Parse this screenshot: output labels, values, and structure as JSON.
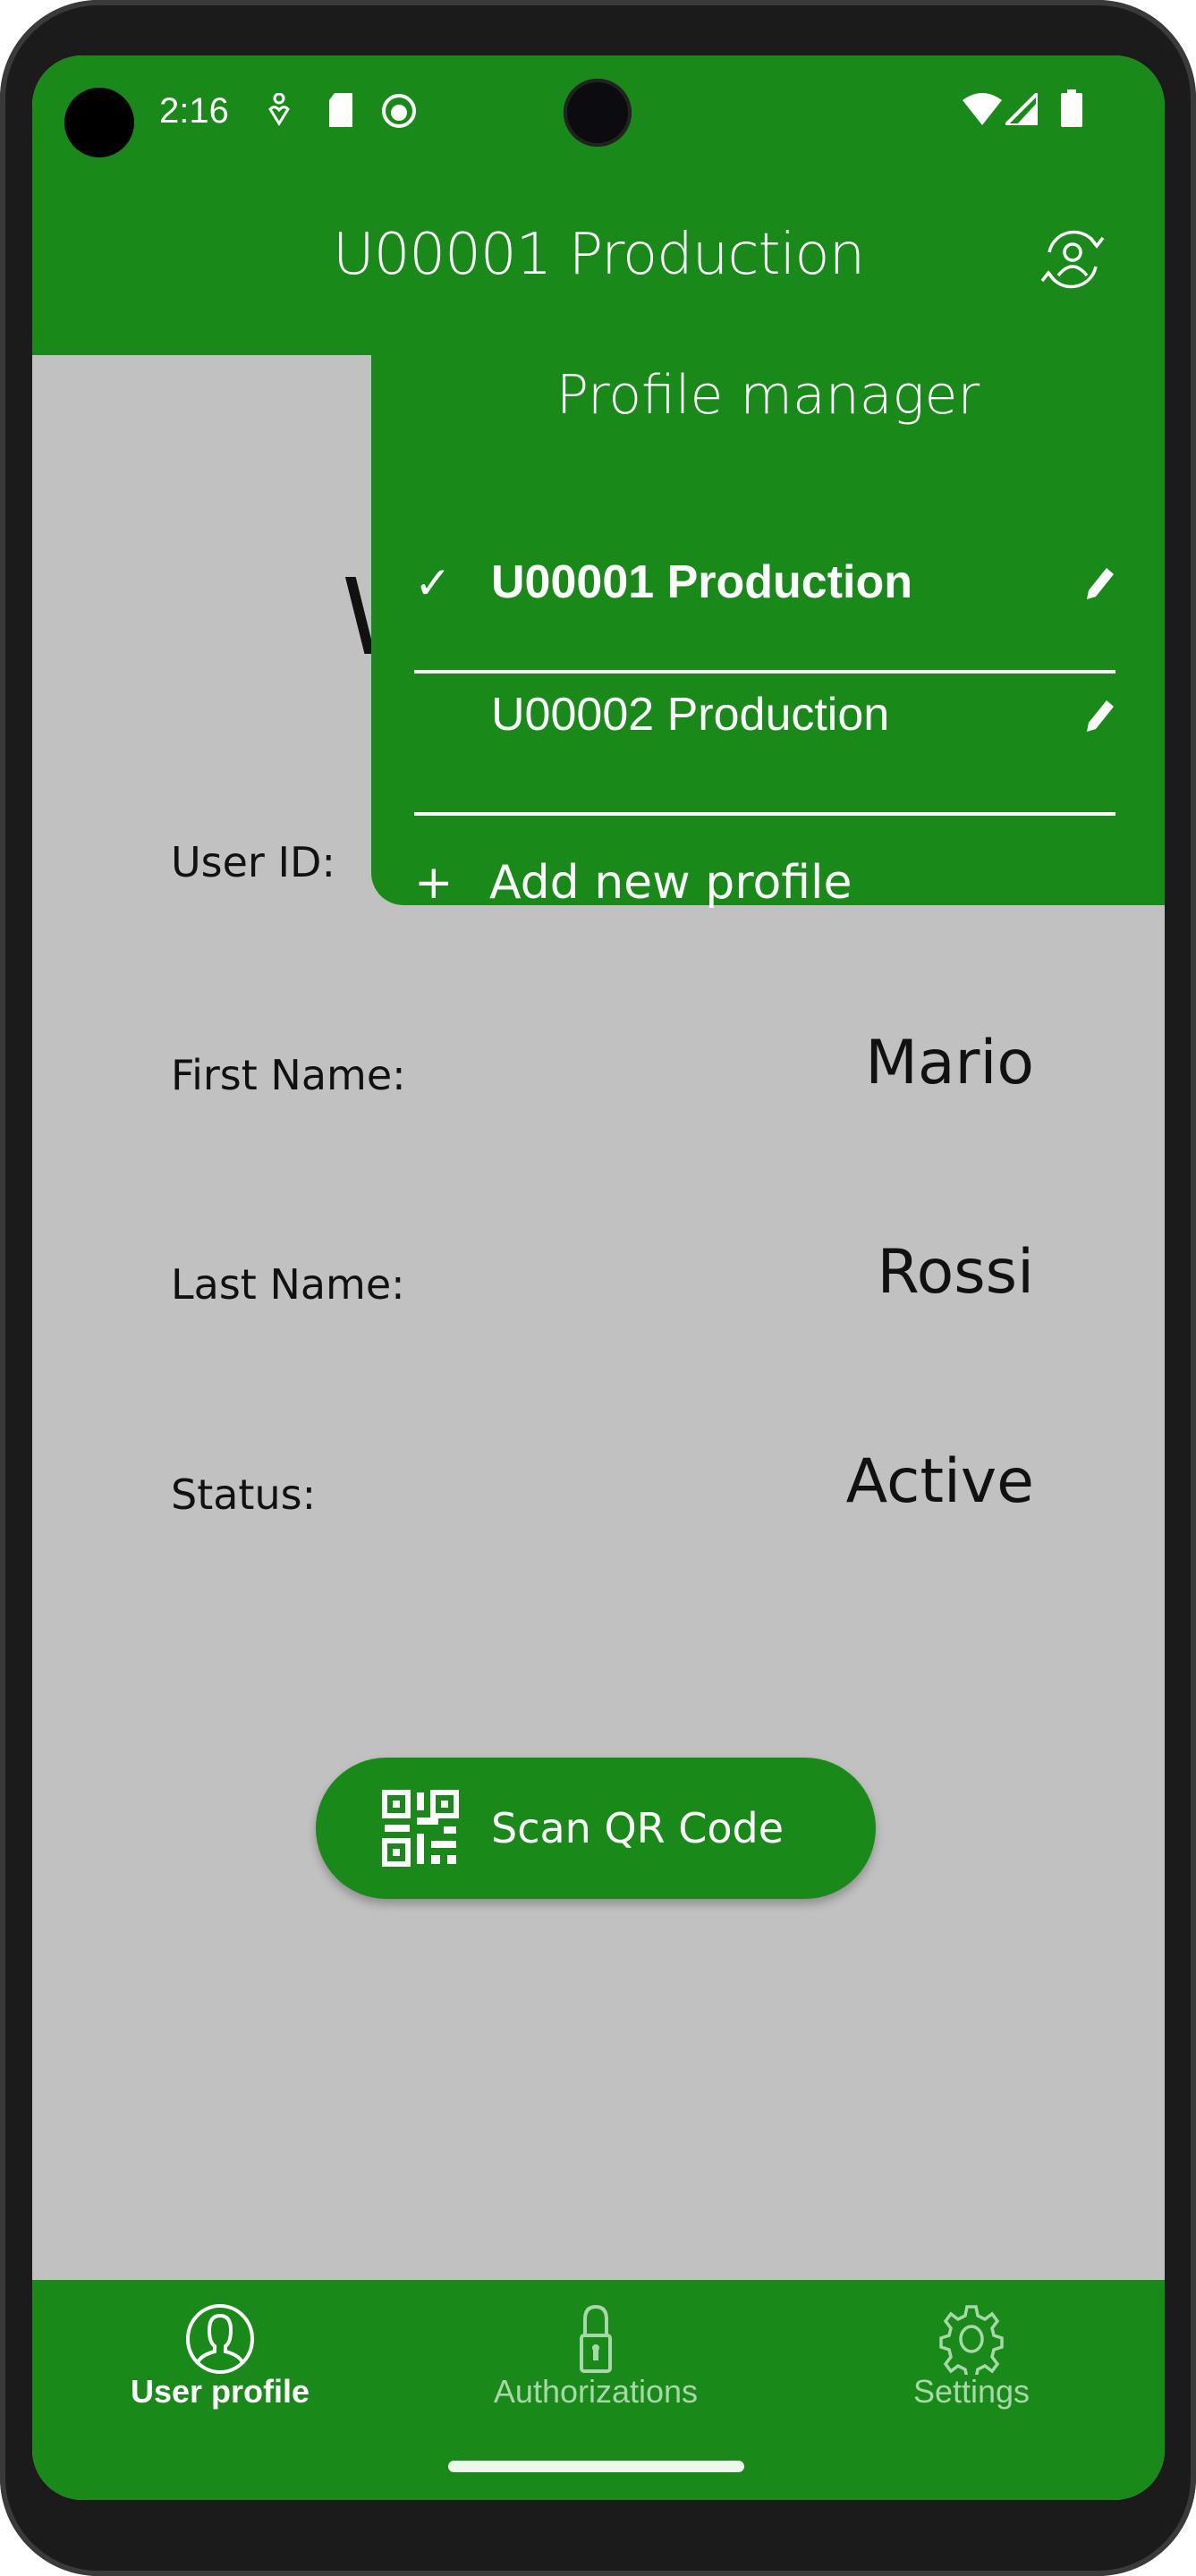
{
  "status_bar": {
    "time": "2:16",
    "icons": [
      "accessibility-icon",
      "sd-card-icon",
      "android-debug-icon",
      "wifi-icon",
      "signal-icon",
      "battery-icon"
    ]
  },
  "app_bar": {
    "title": "U00001 Production",
    "action_icon": "switch-profile-icon"
  },
  "main": {
    "heading_partial": "W",
    "fields": [
      {
        "label": "User ID:",
        "value": ""
      },
      {
        "label": "First Name:",
        "value": "Mario"
      },
      {
        "label": "Last Name:",
        "value": "Rossi"
      },
      {
        "label": "Status:",
        "value": "Active"
      }
    ],
    "scan_button": "Scan QR Code"
  },
  "profile_manager": {
    "title": "Profile manager",
    "profiles": [
      {
        "name": "U00001 Production",
        "selected": true
      },
      {
        "name": "U00002 Production",
        "selected": false
      }
    ],
    "check": "✓",
    "add_plus": "+",
    "add_label": "Add new profile"
  },
  "bottom_nav": {
    "tabs": [
      {
        "label": "User profile",
        "icon": "user-icon",
        "active": true
      },
      {
        "label": "Authorizations",
        "icon": "lock-icon",
        "active": false
      },
      {
        "label": "Settings",
        "icon": "gear-icon",
        "active": false
      }
    ]
  },
  "colors": {
    "primary": "#198a19",
    "background": "#c1c1c1",
    "inactive_tab": "#a8d8a8"
  }
}
